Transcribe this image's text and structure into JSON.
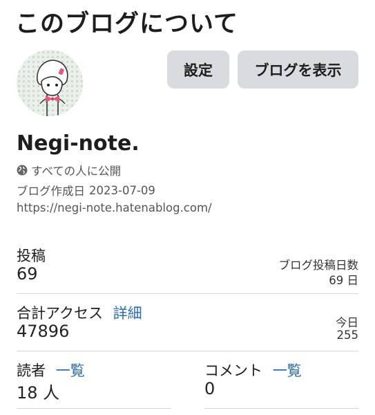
{
  "header": {
    "title": "このブログについて"
  },
  "actions": {
    "settings_label": "設定",
    "view_blog_label": "ブログを表示"
  },
  "blog": {
    "name": "Negi-note.",
    "visibility_icon": "globe-icon",
    "visibility": "すべての人に公開",
    "created_label": "ブログ作成日",
    "created_date": "2023-07-09",
    "url": "https://negi-note.hatenablog.com/"
  },
  "stats": {
    "posts": {
      "label": "投稿",
      "value": "69"
    },
    "posting_days": {
      "label": "ブログ投稿日数",
      "value": "69 日"
    },
    "access": {
      "label": "合計アクセス",
      "detail_link": "詳細",
      "value": "47896"
    },
    "today": {
      "label": "今日",
      "value": "255"
    },
    "readers": {
      "label": "読者",
      "list_link": "一覧",
      "value": "18 人"
    },
    "comments": {
      "label": "コメント",
      "list_link": "一覧",
      "value": "0"
    }
  },
  "colors": {
    "link": "#2a6db5",
    "button_bg": "#d8dcdf",
    "divider": "#d6d6d6",
    "bow": "#e8577a"
  }
}
